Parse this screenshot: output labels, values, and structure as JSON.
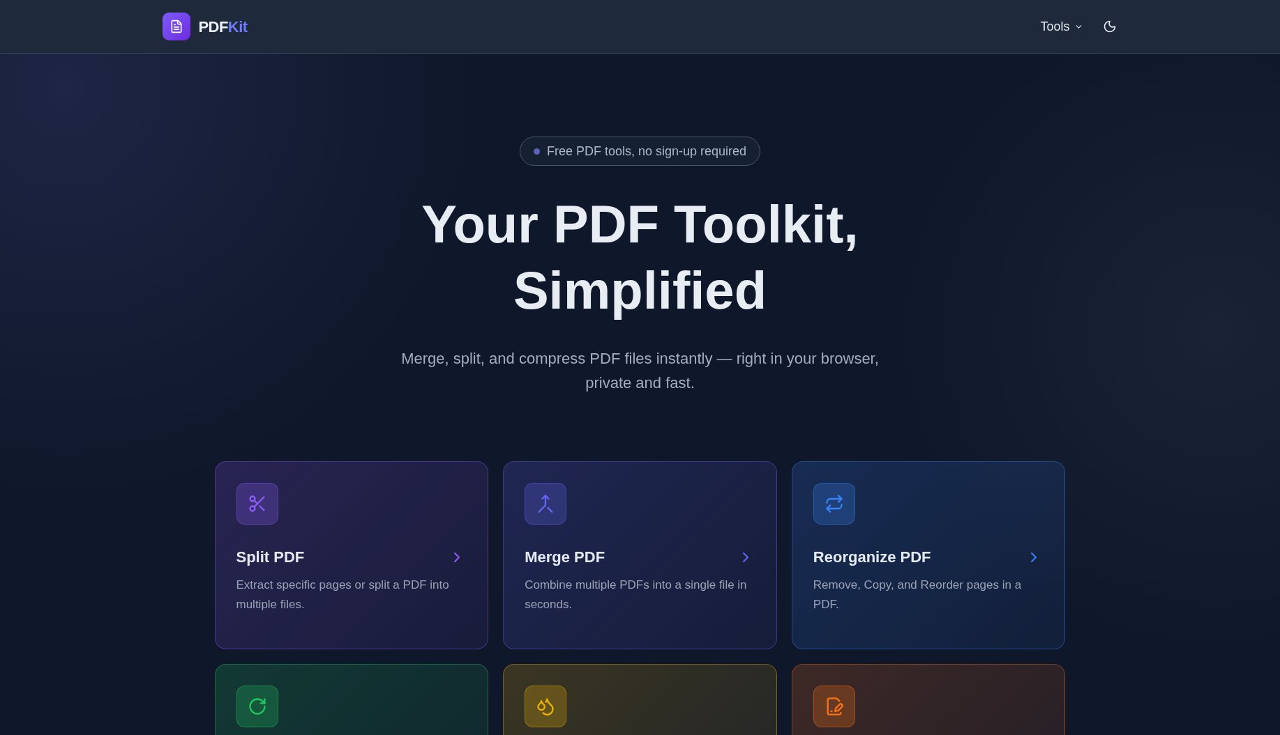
{
  "header": {
    "logo": {
      "prefix": "PDF",
      "suffix": "Kit"
    },
    "nav": [
      {
        "label": "Tools",
        "kind": "dropdown"
      }
    ]
  },
  "hero": {
    "badge": "Free PDF tools, no sign-up required",
    "title_lines": [
      "Your PDF Toolkit,",
      "Simplified"
    ],
    "subtitle": "Merge, split, and compress PDF files instantly — right in your browser, private and fast."
  },
  "tools": [
    {
      "color": "#8b5cf6",
      "title": "Split PDF",
      "description": "Extract specific pages or split a PDF into multiple files."
    },
    {
      "color": "#6366f1",
      "title": "Merge PDF",
      "description": "Combine multiple PDFs into a single file in seconds."
    },
    {
      "color": "#3b82f6",
      "title": "Reorganize PDF",
      "description": "Remove, Copy, and Reorder pages in a PDF."
    },
    {
      "color": "#22c55e"
    },
    {
      "color": "#eab308"
    },
    {
      "color": "#f97316"
    }
  ]
}
